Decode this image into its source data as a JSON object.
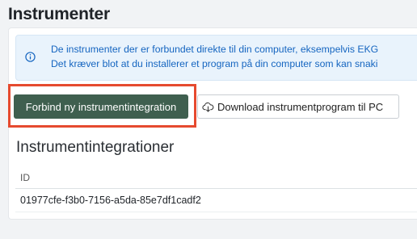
{
  "page": {
    "title": "Instrumenter"
  },
  "info_alert": {
    "icon": "info-circle-icon",
    "line1": "De instrumenter der er forbundet direkte til din computer, eksempelvis EKG",
    "line2": "Det kræver blot at du installerer et program på din computer som kan snaki"
  },
  "actions": {
    "connect_label": "Forbind ny instrumentintegration",
    "download_label": "Download instrumentprogram til PC",
    "download_icon": "cloud-download-icon",
    "highlight_color": "#e64a2f",
    "primary_color": "#3f5f4f"
  },
  "integrations": {
    "title": "Instrumentintegrationer",
    "columns": [
      "ID"
    ],
    "rows": [
      {
        "id": "01977cfe-f3b0-7156-a5da-85e7df1cadf2"
      }
    ]
  }
}
